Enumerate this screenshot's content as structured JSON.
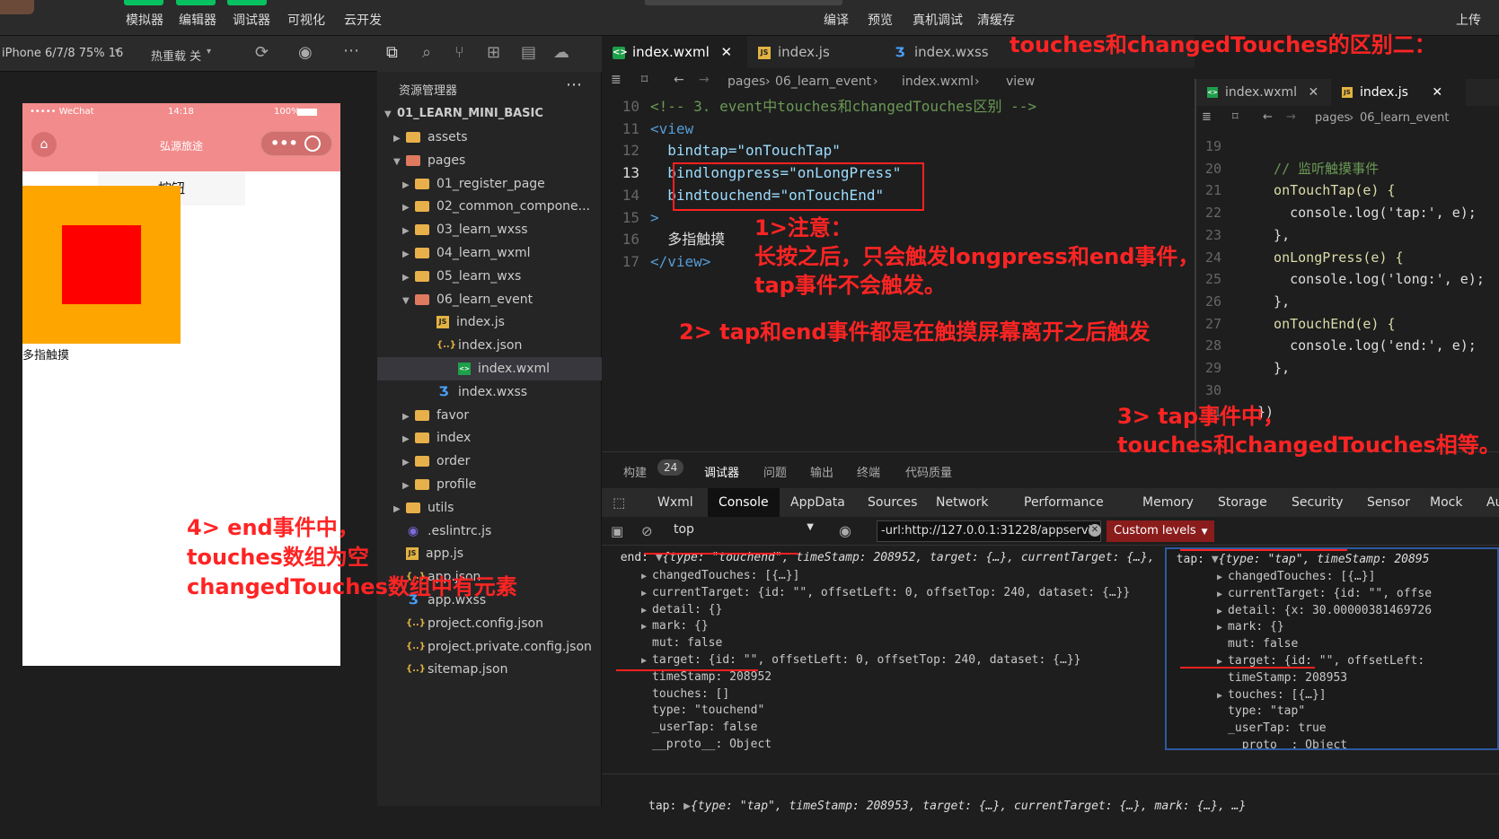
{
  "toolbar": {
    "simulator": "模拟器",
    "editor": "编辑器",
    "debugger": "调试器",
    "visual": "可视化",
    "cloud": "云开发",
    "compile": "编译",
    "preview": "预览",
    "real_debug": "真机调试",
    "clear_cache": "清缓存",
    "upload": "上传"
  },
  "devbar": {
    "device": "iPhone 6/7/8 75% 16",
    "hot_reload": "热重载 关"
  },
  "phone": {
    "carrier": "••••• WeChat",
    "time": "14:18",
    "battery": "100%",
    "nav_title": "弘源旅途",
    "button_label": "按钮",
    "multi_touch": "多指触摸"
  },
  "explorer": {
    "title": "资源管理器",
    "project": "01_LEARN_MINI_BASIC",
    "items": [
      {
        "label": "assets",
        "type": "folder",
        "depth": 1
      },
      {
        "label": "pages",
        "type": "folder-open",
        "depth": 1
      },
      {
        "label": "01_register_page",
        "type": "folder",
        "depth": 2
      },
      {
        "label": "02_common_compone...",
        "type": "folder",
        "depth": 2
      },
      {
        "label": "03_learn_wxss",
        "type": "folder",
        "depth": 2
      },
      {
        "label": "04_learn_wxml",
        "type": "folder",
        "depth": 2
      },
      {
        "label": "05_learn_wxs",
        "type": "folder",
        "depth": 2
      },
      {
        "label": "06_learn_event",
        "type": "folder-open",
        "depth": 2
      },
      {
        "label": "index.js",
        "type": "js",
        "depth": 3
      },
      {
        "label": "index.json",
        "type": "json",
        "depth": 3
      },
      {
        "label": "index.wxml",
        "type": "wxml",
        "depth": 3
      },
      {
        "label": "index.wxss",
        "type": "wxss",
        "depth": 3
      },
      {
        "label": "favor",
        "type": "folder",
        "depth": 2
      },
      {
        "label": "index",
        "type": "folder",
        "depth": 2
      },
      {
        "label": "order",
        "type": "folder",
        "depth": 2
      },
      {
        "label": "profile",
        "type": "folder",
        "depth": 2
      },
      {
        "label": "utils",
        "type": "folder",
        "depth": 1
      },
      {
        "label": ".eslintrc.js",
        "type": "eslint",
        "depth": 1
      },
      {
        "label": "app.js",
        "type": "js",
        "depth": 1
      },
      {
        "label": "app.json",
        "type": "json",
        "depth": 1
      },
      {
        "label": "app.wxss",
        "type": "wxss",
        "depth": 1
      },
      {
        "label": "project.config.json",
        "type": "json",
        "depth": 1
      },
      {
        "label": "project.private.config.json",
        "type": "json",
        "depth": 1
      },
      {
        "label": "sitemap.json",
        "type": "json",
        "depth": 1
      }
    ]
  },
  "editor": {
    "tabs": [
      "index.wxml",
      "index.js",
      "index.wxss"
    ],
    "breadcrumb": [
      "pages",
      "06_learn_event",
      "index.wxml",
      "view"
    ],
    "lines": [
      {
        "n": "10",
        "code": "<!-- 3. event中touches和changedTouches区别 -->"
      },
      {
        "n": "11",
        "code": "<view"
      },
      {
        "n": "12",
        "code": "  bindtap=\"onTouchTap\""
      },
      {
        "n": "13",
        "code": "  bindlongpress=\"onLongPress\""
      },
      {
        "n": "14",
        "code": "  bindtouchend=\"onTouchEnd\""
      },
      {
        "n": "15",
        "code": ">"
      },
      {
        "n": "16",
        "code": "  多指触摸"
      },
      {
        "n": "17",
        "code": "</view>"
      }
    ]
  },
  "editor2": {
    "tabs": [
      "index.wxml",
      "index.js"
    ],
    "breadcrumb": [
      "pages",
      "06_learn_event"
    ],
    "lines": [
      {
        "n": "19",
        "code": ""
      },
      {
        "n": "20",
        "code": "  // 监听触摸事件"
      },
      {
        "n": "21",
        "code": "  onTouchTap(e) {"
      },
      {
        "n": "22",
        "code": "    console.log('tap:', e);"
      },
      {
        "n": "23",
        "code": "  },"
      },
      {
        "n": "24",
        "code": "  onLongPress(e) {"
      },
      {
        "n": "25",
        "code": "    console.log('long:', e);"
      },
      {
        "n": "26",
        "code": "  },"
      },
      {
        "n": "27",
        "code": "  onTouchEnd(e) {"
      },
      {
        "n": "28",
        "code": "    console.log('end:', e);"
      },
      {
        "n": "29",
        "code": "  },"
      },
      {
        "n": "30",
        "code": ""
      },
      {
        "n": "31",
        "code": "})"
      }
    ]
  },
  "panel": {
    "tabs": [
      "构建",
      "调试器",
      "问题",
      "输出",
      "终端",
      "代码质量"
    ],
    "build_count": "24",
    "devtools_tabs": [
      "Wxml",
      "Console",
      "AppData",
      "Sources",
      "Network",
      "Performance",
      "Memory",
      "Storage",
      "Security",
      "Sensor",
      "Mock",
      "Au"
    ],
    "context": "top",
    "filter": "-url:http://127.0.0.1:31228/appservic",
    "levels": "Custom levels"
  },
  "console_end": {
    "label": "end:",
    "head": "{type: \"touchend\", timeStamp: 208952, target: {…}, currentTarget: {…},",
    "rows": [
      "changedTouches: [{…}]",
      "currentTarget: {id: \"\", offsetLeft: 0, offsetTop: 240, dataset: {…}}",
      "detail: {}",
      "mark: {}",
      "mut: false",
      "target: {id: \"\", offsetLeft: 0, offsetTop: 240, dataset: {…}}",
      "timeStamp: 208952",
      "touches: []",
      "type: \"touchend\"",
      "_userTap: false",
      "__proto__: Object"
    ]
  },
  "console_tap": {
    "label": "tap:",
    "head": "{type: \"tap\", timeStamp: 20895",
    "rows": [
      "changedTouches: [{…}]",
      "currentTarget: {id: \"\", offse",
      "detail: {x: 30.00000381469726",
      "mark: {}",
      "mut: false",
      "target: {id: \"\", offsetLeft:",
      "timeStamp: 208953",
      "touches: [{…}]",
      "type: \"tap\"",
      "_userTap: true",
      "__proto__: Object"
    ]
  },
  "console_tap_line": {
    "label": "tap:",
    "text": "{type: \"tap\", timeStamp: 208953, target: {…}, currentTarget: {…}, mark: {…}, …}"
  },
  "annotations": {
    "title": "touches和changedTouches的区别二：",
    "note1_a": "1>注意：",
    "note1_b": "长按之后，只会触发longpress和end事件，",
    "note1_c": "tap事件不会触发。",
    "note2": "2> tap和end事件都是在触摸屏幕离开之后触发",
    "note3_a": "3> tap事件中，",
    "note3_b": "touches和changedTouches相等。",
    "note4_a": "4> end事件中，",
    "note4_b": "touches数组为空",
    "note4_c": "changedTouches数组中有元素"
  },
  "colors": {
    "annotation": "#ff2424",
    "nav_pink": "#f28b8b",
    "orange_box": "#ffa500",
    "red_box": "#ff0000"
  }
}
